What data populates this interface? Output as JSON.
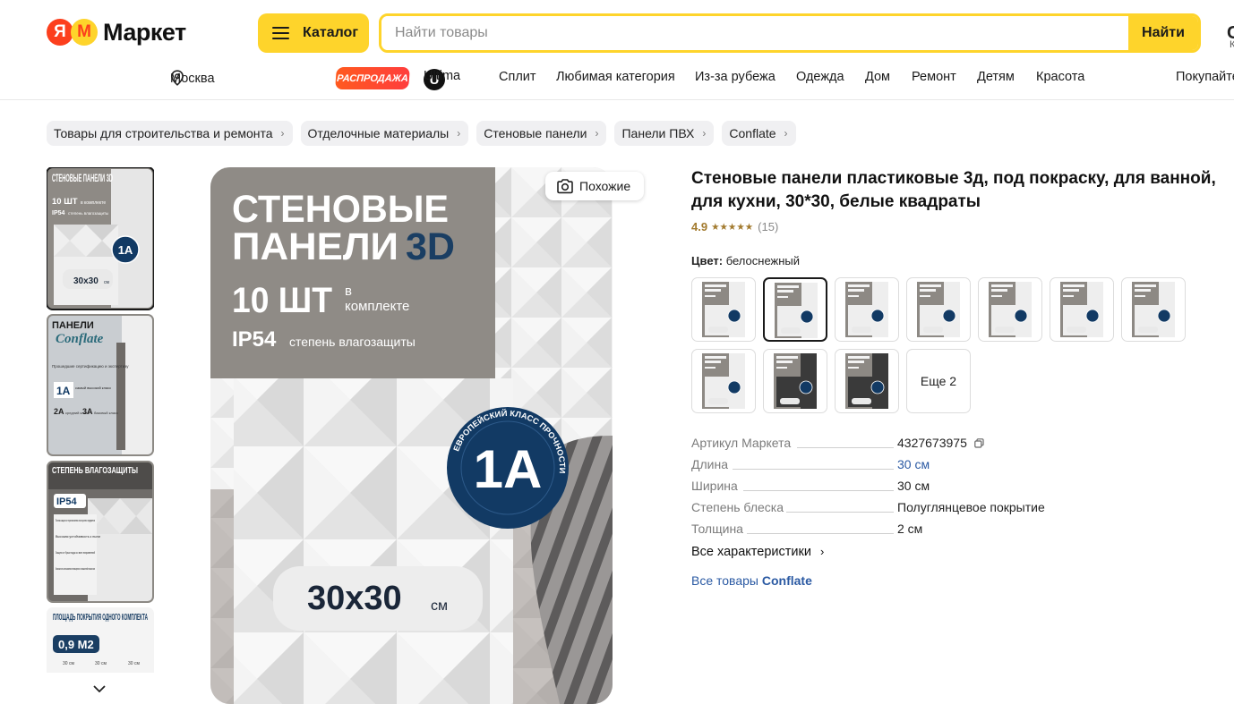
{
  "header": {
    "logo_ya": "Я",
    "logo_m": "М",
    "logo_text": "Маркет",
    "catalog_label": "Каталог",
    "search_placeholder": "Найти товары",
    "search_button": "Найти",
    "edge_char_1": "С",
    "edge_char_2": "К"
  },
  "nav": {
    "city": "Москва",
    "sale_badge": "РАСПРОДАЖА",
    "ultima_badge": "U",
    "items": [
      "Ultima",
      "Сплит",
      "Любимая категория",
      "Из-за рубежа",
      "Одежда",
      "Дом",
      "Ремонт",
      "Детям",
      "Красота",
      "Покупайте"
    ]
  },
  "breadcrumbs": [
    "Товары для строительства и ремонта",
    "Отделочные материалы",
    "Стеновые панели",
    "Панели ПВХ",
    "Conflate"
  ],
  "thumbnails": [
    {
      "title": "СТЕНОВЫЕ ПАНЕЛИ 3D",
      "line1": "10 ШТ",
      "line1_small": "в комплекте",
      "line2": "IP54",
      "line2_small": "степень влагозащиты",
      "badge": "1A",
      "size": "30x30",
      "unit": "см"
    },
    {
      "title": "ПАНЕЛИ",
      "brand": "Conflate",
      "body": "Прошедшие сертификацию и экспертизу",
      "badge": "1A",
      "badge_text": "самый высокий класс",
      "class2": "2A",
      "class2_text": "средний класс",
      "class3": "3A",
      "class3_text": "базовый класс"
    },
    {
      "title": "СТЕПЕНЬ ВЛАГОЗАЩИТЫ",
      "badge": "IP54",
      "items": [
        "Полная защита от проникновения посторонних предметов",
        "Высокая устойчивость к пыли",
        "Защита от брызг воды со всех направлений",
        "Возможность использования в помещениях с повышенной влажностью"
      ]
    },
    {
      "title": "ПЛОЩАДЬ ПОКРЫТИЯ ОДНОГО КОМПЛЕКТА",
      "badge": "0,9 М2",
      "dims": [
        "30 см",
        "30 см",
        "30 см"
      ]
    }
  ],
  "main_image": {
    "title_line1": "СТЕНОВЫЕ",
    "title_line2": "ПАНЕЛИ",
    "title_accent": "3D",
    "qty": "10 ШТ",
    "qty_small_1": "в",
    "qty_small_2": "комплекте",
    "ip": "IP54",
    "ip_small": "степень влагозащиты",
    "badge": "1A",
    "badge_ring_text": "ЕВРОПЕЙСКИЙ КЛАСС ПРОЧНОСТИ",
    "size": "30x30",
    "unit": "см",
    "similar_button": "Похожие"
  },
  "product": {
    "title": "Стеновые панели пластиковые 3д, под покраску, для ванной, для кухни, 30*30, белые квадраты",
    "rating": "4.9",
    "stars": 4.5,
    "reviews": "(15)",
    "color_label": "Цвет:",
    "color_value": "белоснежный",
    "more_colors": "Еще 2",
    "specs": [
      {
        "key": "Артикул Маркета",
        "value": "4327673975"
      },
      {
        "key": "Длина",
        "value": "30 см"
      },
      {
        "key": "Ширина",
        "value": "30 см"
      },
      {
        "key": "Степень блеска",
        "value": "Полуглянцевое покрытие"
      },
      {
        "key": "Толщина",
        "value": "2 см"
      }
    ],
    "all_chars": "Все характеристики",
    "all_goods_prefix": "Все товары",
    "all_goods_brand": "Conflate"
  },
  "colors": {
    "brand_yellow": "#fed42b",
    "logo_red": "#fc3f1d",
    "link_blue": "#2b5aa3",
    "rating_gold": "#a27a2e",
    "badge_navy": "#123a64"
  },
  "icons": [
    "location-pin-icon",
    "burger-icon",
    "camera-search-icon",
    "copy-icon",
    "chevron-right-icon",
    "chevron-down-icon",
    "star-icon"
  ]
}
